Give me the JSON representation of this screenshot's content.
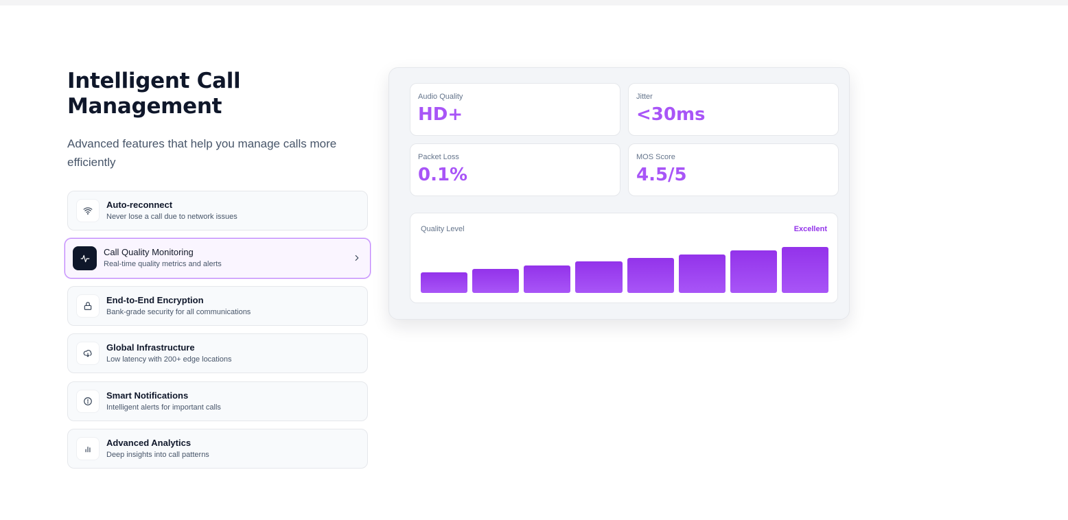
{
  "header": {
    "title": "Intelligent Call Management",
    "subtitle": "Advanced features that help you manage calls more efficiently"
  },
  "features": [
    {
      "icon": "wifi-icon",
      "name": "Auto-reconnect",
      "desc": "Never lose a call due to network issues",
      "active": false
    },
    {
      "icon": "activity-icon",
      "name": "Call Quality Monitoring",
      "desc": "Real-time quality metrics and alerts",
      "active": true
    },
    {
      "icon": "lock-icon",
      "name": "End-to-End Encryption",
      "desc": "Bank-grade security for all communications",
      "active": false
    },
    {
      "icon": "cloud-icon",
      "name": "Global Infrastructure",
      "desc": "Low latency with 200+ edge locations",
      "active": false
    },
    {
      "icon": "alert-circle-icon",
      "name": "Smart Notifications",
      "desc": "Intelligent alerts for important calls",
      "active": false
    },
    {
      "icon": "bar-chart-icon",
      "name": "Advanced Analytics",
      "desc": "Deep insights into call patterns",
      "active": false
    }
  ],
  "metrics": [
    {
      "label": "Audio Quality",
      "value": "HD+"
    },
    {
      "label": "Jitter",
      "value": "<30ms"
    },
    {
      "label": "Packet Loss",
      "value": "0.1%"
    },
    {
      "label": "MOS Score",
      "value": "4.5/5"
    }
  ],
  "quality": {
    "label": "Quality Level",
    "status": "Excellent",
    "bar_levels": [
      0.45,
      0.52,
      0.6,
      0.68,
      0.76,
      0.84,
      0.92,
      1.0
    ]
  },
  "colors": {
    "accent": "#a855f7",
    "accent_dark": "#9333ea",
    "active_icon_bg": "#0f172a"
  }
}
